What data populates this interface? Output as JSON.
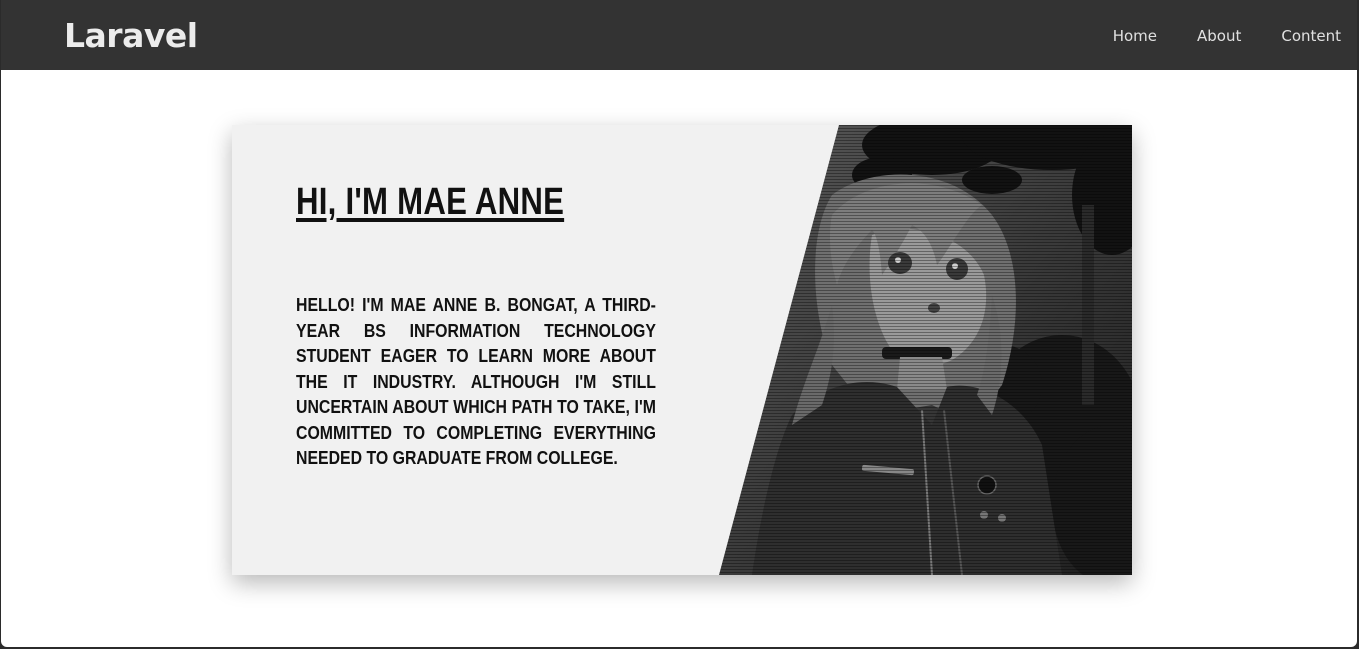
{
  "navbar": {
    "brand": "Laravel",
    "links": [
      {
        "label": "Home"
      },
      {
        "label": "About"
      },
      {
        "label": "Content"
      }
    ]
  },
  "hero": {
    "headline": "HI, I'M MAE ANNE",
    "bio": "Hello! I'm Mae Anne B. Bongat, a third-year BS Information Technology student eager to learn more about the IT industry. Although I'm still uncertain about which path to take, I'm committed to completing everything needed to graduate from college.",
    "image": "grayscale anime girl portrait with trees"
  },
  "colors": {
    "navbar_bg": "#333333",
    "nav_text": "#e0e0e0",
    "page_bg": "#ffffff",
    "card_bg": "#f1f1f1",
    "text": "#111111"
  }
}
